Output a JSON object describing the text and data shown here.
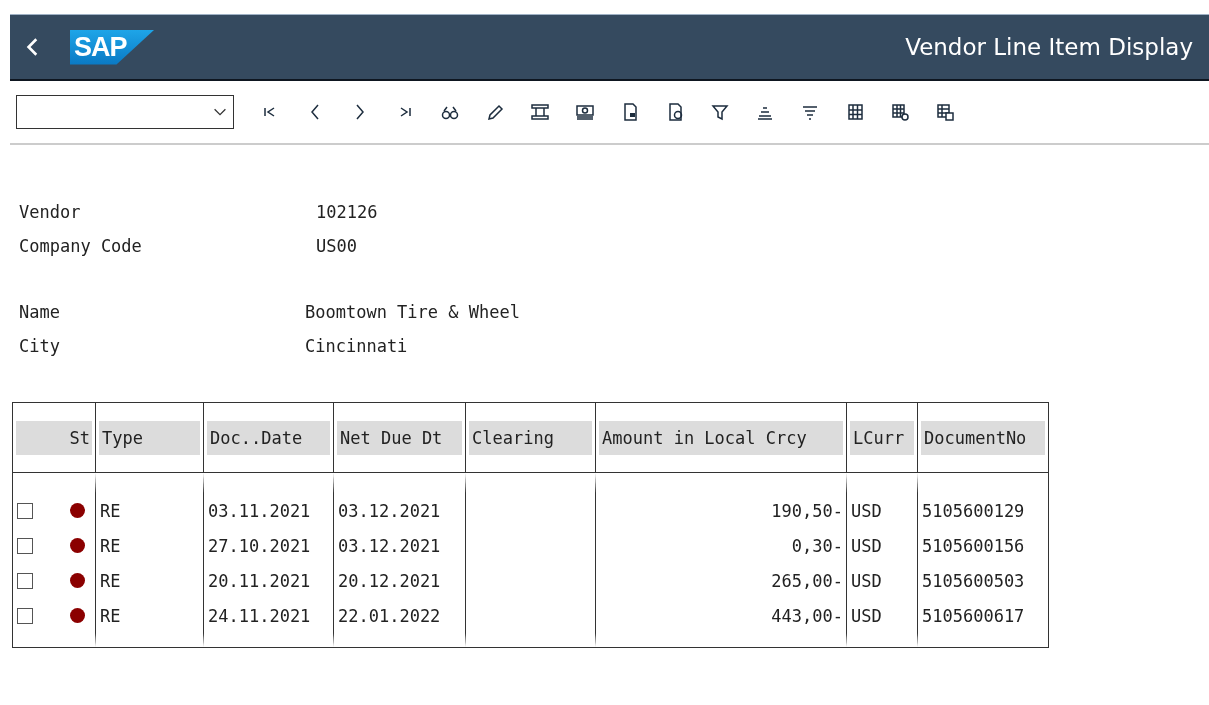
{
  "header": {
    "logo": "SAP",
    "title": "Vendor Line Item Display"
  },
  "fields": [
    [
      {
        "label": "Vendor",
        "value": "102126"
      },
      {
        "label": "Company Code",
        "value": "US00"
      }
    ],
    [
      {
        "label": "Name",
        "value": "Boomtown Tire & Wheel"
      },
      {
        "label": "City",
        "value": "Cincinnati"
      }
    ]
  ],
  "table": {
    "columns": [
      "St",
      "Type",
      "Doc..Date",
      "Net Due Dt",
      "Clearing",
      "Amount in Local Crcy",
      "LCurr",
      "DocumentNo"
    ],
    "rows": [
      {
        "checked": false,
        "color": "#8b0000",
        "type": "RE",
        "doc_date": "03.11.2021",
        "net_due": "03.12.2021",
        "amount": "190,50-",
        "currency": "USD",
        "document_no": "5105600129"
      },
      {
        "checked": false,
        "color": "#8b0000",
        "type": "RE",
        "doc_date": "27.10.2021",
        "net_due": "03.12.2021",
        "amount": "0,30-",
        "currency": "USD",
        "document_no": "5105600156"
      },
      {
        "checked": false,
        "color": "#8b0000",
        "type": "RE",
        "doc_date": "20.11.2021",
        "net_due": "20.12.2021",
        "amount": "265,00-",
        "currency": "USD",
        "document_no": "5105600503"
      },
      {
        "checked": false,
        "color": "#8b0000",
        "type": "RE",
        "doc_date": "24.11.2021",
        "net_due": "22.01.2022",
        "amount": "443,00-",
        "currency": "USD",
        "document_no": "5105600617"
      }
    ]
  }
}
